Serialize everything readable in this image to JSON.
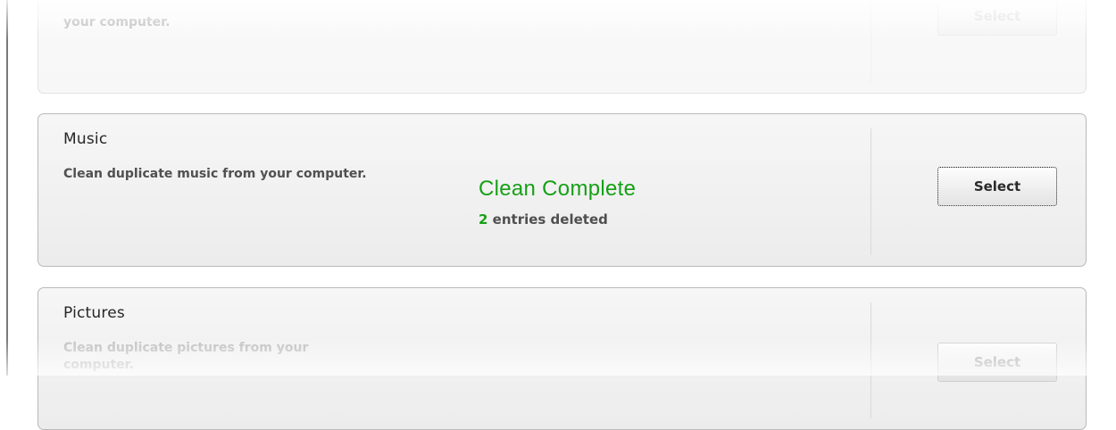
{
  "categories": [
    {
      "id": "previous",
      "description": "your computer.",
      "button_label": "Select"
    },
    {
      "id": "music",
      "title": "Music",
      "description": "Clean duplicate music from your computer.",
      "status_title": "Clean Complete",
      "status_count": "2",
      "status_suffix": "entries deleted",
      "button_label": "Select"
    },
    {
      "id": "pictures",
      "title": "Pictures",
      "description": "Clean duplicate pictures from your computer.",
      "button_label": "Select"
    }
  ],
  "colors": {
    "status_green": "#16a016",
    "card_border": "#b9b9b9",
    "card_background": "#f0f0f0"
  }
}
